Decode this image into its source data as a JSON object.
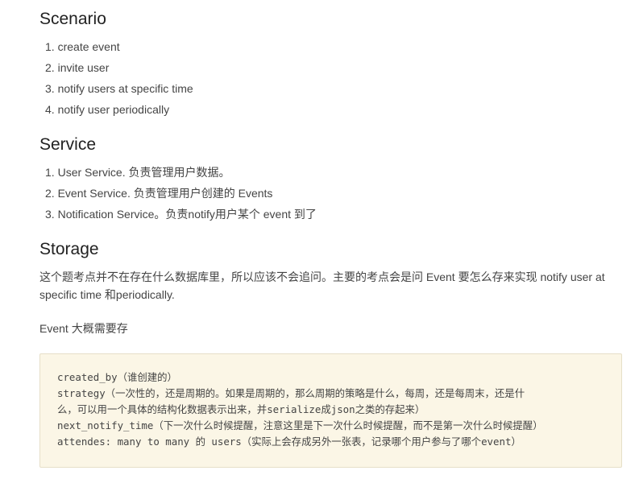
{
  "scenario": {
    "heading": "Scenario",
    "items": [
      {
        "num": "1.",
        "text": "create event"
      },
      {
        "num": "2.",
        "text": "invite user"
      },
      {
        "num": "3.",
        "text": "notify users at specific time"
      },
      {
        "num": "4.",
        "text": "notify user periodically"
      }
    ]
  },
  "service": {
    "heading": "Service",
    "items": [
      {
        "num": "1.",
        "text": "User Service. 负责管理用户数据。"
      },
      {
        "num": "2.",
        "text": "Event Service. 负责管理用户创建的 Events"
      },
      {
        "num": "3.",
        "text": "Notification Service。负责notify用户某个 event 到了"
      }
    ]
  },
  "storage": {
    "heading": "Storage",
    "paragraph_line1": "这个题考点并不在存在什么数据库里，所以应该不会追问。主要的考点会是问 Event 要怎么存来实现 notify user at",
    "paragraph_line2": "specific time 和periodically.",
    "event_label": "Event 大概需要存",
    "code_lines": [
      "created_by（谁创建的）",
      "strategy（一次性的，还是周期的。如果是周期的，那么周期的策略是什么，每周，还是每周末，还是什",
      "么，可以用一个具体的结构化数据表示出来，并serialize成json之类的存起来）",
      "next_notify_time（下一次什么时候提醒，注意这里是下一次什么时候提醒，而不是第一次什么时候提醒）",
      "attendes: many to many 的 users（实际上会存成另外一张表，记录哪个用户参与了哪个event）"
    ]
  }
}
